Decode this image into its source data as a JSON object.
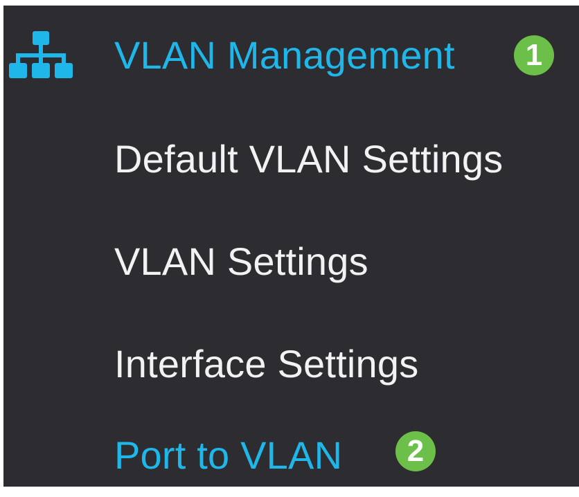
{
  "menu": {
    "header": {
      "label": "VLAN Management",
      "icon": "network-hierarchy-icon",
      "badge": "1",
      "accent_color": "#1fb7ea"
    },
    "items": [
      {
        "label": "Default VLAN Settings"
      },
      {
        "label": "VLAN Settings"
      },
      {
        "label": "Interface Settings"
      },
      {
        "label": "Port to VLAN",
        "badge": "2",
        "highlighted": true
      }
    ]
  },
  "colors": {
    "panel_background": "#2d2c31",
    "text_normal": "#f2f2f2",
    "text_accent": "#1fb7ea",
    "badge_green": "#6cc04a"
  }
}
